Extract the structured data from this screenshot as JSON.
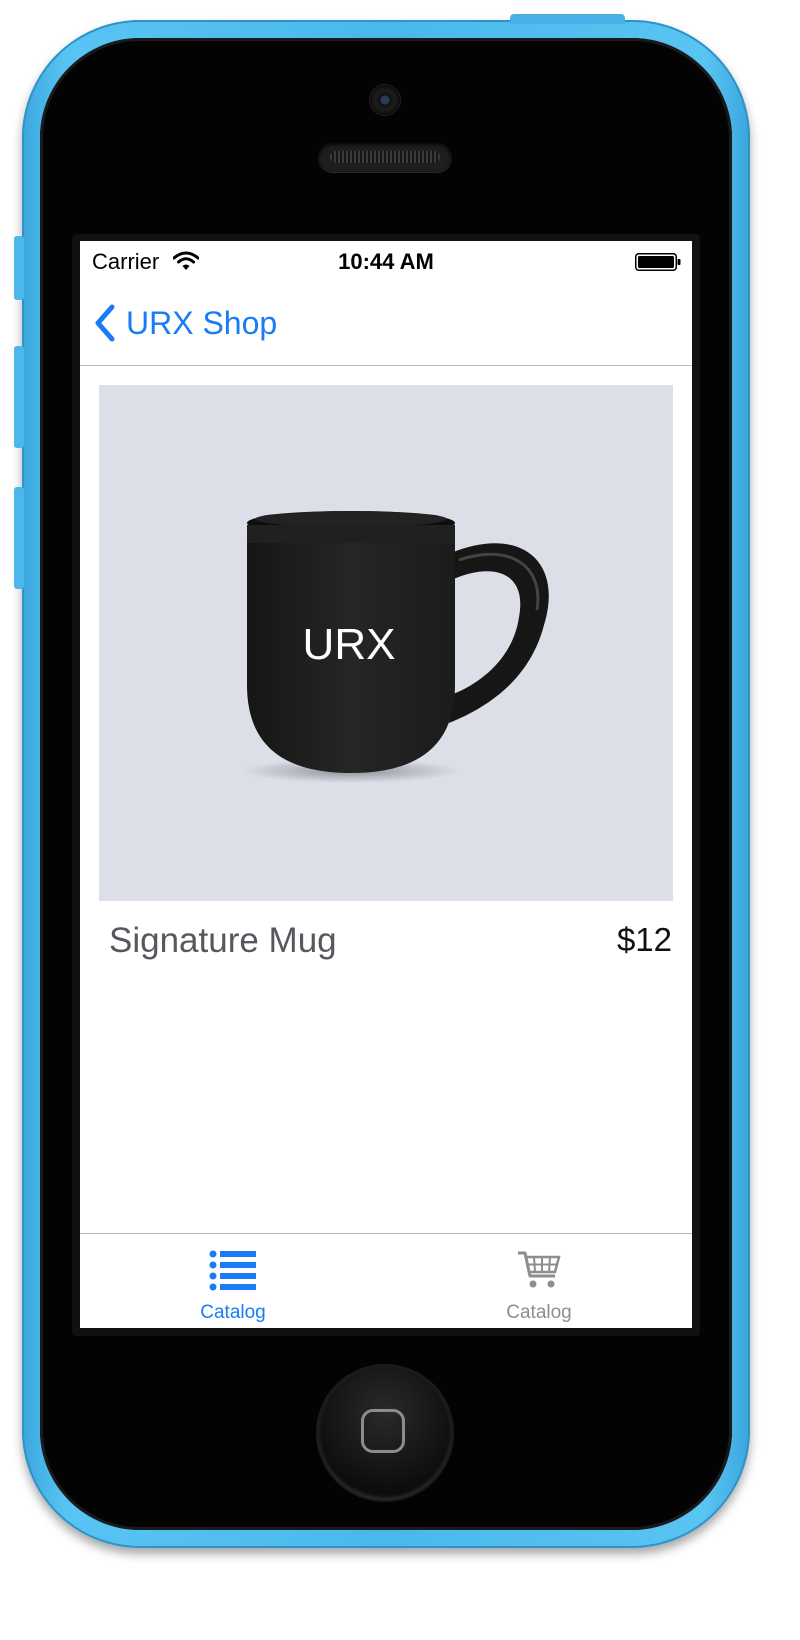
{
  "status_bar": {
    "carrier": "Carrier",
    "time": "10:44 AM",
    "icons": [
      "wifi-icon",
      "battery-icon"
    ]
  },
  "nav_bar": {
    "back_label": "URX Shop",
    "back_icon": "chevron-left-icon"
  },
  "product": {
    "name": "Signature Mug",
    "price": "$12",
    "image_text": "URX",
    "image_background": "#dcdfe8"
  },
  "tab_bar": {
    "tabs": [
      {
        "label": "Catalog",
        "icon": "list-icon",
        "active": true
      },
      {
        "label": "Catalog",
        "icon": "cart-icon",
        "active": false
      }
    ]
  },
  "colors": {
    "accent": "#1a7cf5",
    "inactive_tab": "#8e8e8e",
    "phone_body": "#4ab8ec"
  }
}
